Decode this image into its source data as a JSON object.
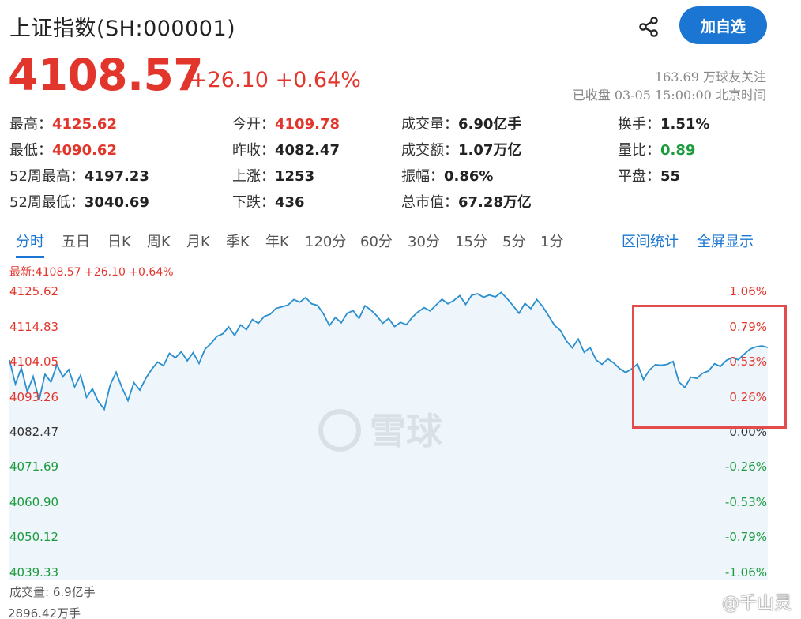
{
  "header": {
    "title": "上证指数(SH:000001)",
    "follow_label": "加自选",
    "price": "4108.57",
    "change": "+26.10 +0.64%",
    "followers": "163.69 万球友关注",
    "status": "已收盘 03-05 15:00:00 北京时间"
  },
  "stats": [
    {
      "label": "最高：",
      "value": "4125.62",
      "color": "red"
    },
    {
      "label": "今开：",
      "value": "4109.78",
      "color": "red"
    },
    {
      "label": "成交量：",
      "value": "6.90亿手",
      "color": "dark"
    },
    {
      "label": "换手：",
      "value": "1.51%",
      "color": "dark"
    },
    {
      "label": "最低：",
      "value": "4090.62",
      "color": "red"
    },
    {
      "label": "昨收：",
      "value": "4082.47",
      "color": "dark"
    },
    {
      "label": "成交额：",
      "value": "1.07万亿",
      "color": "dark"
    },
    {
      "label": "量比：",
      "value": "0.89",
      "color": "green"
    },
    {
      "label": "52周最高：",
      "value": "4197.23",
      "color": "dark"
    },
    {
      "label": "上涨：",
      "value": "1253",
      "color": "dark"
    },
    {
      "label": "振幅：",
      "value": "0.86%",
      "color": "dark"
    },
    {
      "label": "平盘：",
      "value": "55",
      "color": "dark"
    },
    {
      "label": "52周最低：",
      "value": "3040.69",
      "color": "dark"
    },
    {
      "label": "下跌：",
      "value": "436",
      "color": "dark"
    },
    {
      "label": "总市值：",
      "value": "67.28万亿",
      "color": "dark"
    }
  ],
  "tabs": [
    "分时",
    "五日",
    "日K",
    "周K",
    "月K",
    "季K",
    "年K",
    "120分",
    "60分",
    "30分",
    "15分",
    "5分",
    "1分"
  ],
  "active_tab": "分时",
  "tab_actions": [
    "区间统计",
    "全屏显示"
  ],
  "chart_latest": "最新:4108.57 +26.10 +0.64%",
  "volume_label": "成交量: 6.9亿手",
  "volume_value": "2896.42万手",
  "watermark_logo": "雪球",
  "signature": "@千山灵",
  "colors": {
    "accent": "#1a76d2",
    "up": "#e2352b",
    "down": "#1a9b3c",
    "line": "#2a8fcf",
    "highlight": "#e24c4c"
  },
  "chart_data": {
    "type": "line",
    "title": "",
    "ylim": [
      4039.33,
      4125.62
    ],
    "base": 4082.47,
    "y_labels_left": [
      "4125.62",
      "4114.83",
      "4104.05",
      "4093.26",
      "4082.47",
      "4071.69",
      "4060.90",
      "4050.12",
      "4039.33"
    ],
    "y_labels_right": [
      "1.06%",
      "0.79%",
      "0.53%",
      "0.26%",
      "0.00%",
      "-0.26%",
      "-0.53%",
      "-0.79%",
      "-1.06%"
    ],
    "series": [
      {
        "values": [
          4104.5,
          4097.2,
          4102.1,
          4094.8,
          4099.5,
          4092.3,
          4100.2,
          4097.8,
          4103.1,
          4099.4,
          4101.6,
          4096.3,
          4099.9,
          4093.1,
          4095.7,
          4091.8,
          4089.4,
          4096.9,
          4100.8,
          4096.0,
          4092.1,
          4097.6,
          4095.3,
          4098.9,
          4101.7,
          4103.9,
          4102.8,
          4106.6,
          4105.2,
          4107.1,
          4104.3,
          4106.8,
          4103.5,
          4107.9,
          4109.6,
          4111.8,
          4112.6,
          4114.7,
          4112.1,
          4115.3,
          4113.9,
          4117.0,
          4115.8,
          4117.9,
          4118.6,
          4120.4,
          4120.9,
          4121.4,
          4123.1,
          4122.3,
          4123.7,
          4121.8,
          4121.3,
          4118.7,
          4115.1,
          4117.6,
          4116.0,
          4118.9,
          4119.7,
          4117.3,
          4121.2,
          4119.9,
          4118.1,
          4115.8,
          4117.3,
          4114.8,
          4116.1,
          4115.4,
          4117.7,
          4119.4,
          4120.6,
          4119.6,
          4121.4,
          4123.2,
          4121.8,
          4122.8,
          4124.3,
          4121.6,
          4124.4,
          4124.9,
          4123.8,
          4124.5,
          4123.9,
          4125.3,
          4123.4,
          4121.2,
          4118.9,
          4121.9,
          4120.3,
          4123.1,
          4121.0,
          4118.1,
          4115.2,
          4113.6,
          4110.4,
          4108.3,
          4111.0,
          4106.9,
          4108.4,
          4104.6,
          4103.2,
          4104.9,
          4103.6,
          4101.9,
          4100.7,
          4101.8,
          4103.3,
          4098.6,
          4101.4,
          4103.1,
          4102.9,
          4103.2,
          4104.1,
          4097.8,
          4096.1,
          4099.3,
          4098.9,
          4100.5,
          4101.2,
          4103.4,
          4102.6,
          4104.4,
          4105.3,
          4104.6,
          4106.3,
          4107.9,
          4108.6,
          4108.9,
          4108.4
        ]
      }
    ]
  }
}
